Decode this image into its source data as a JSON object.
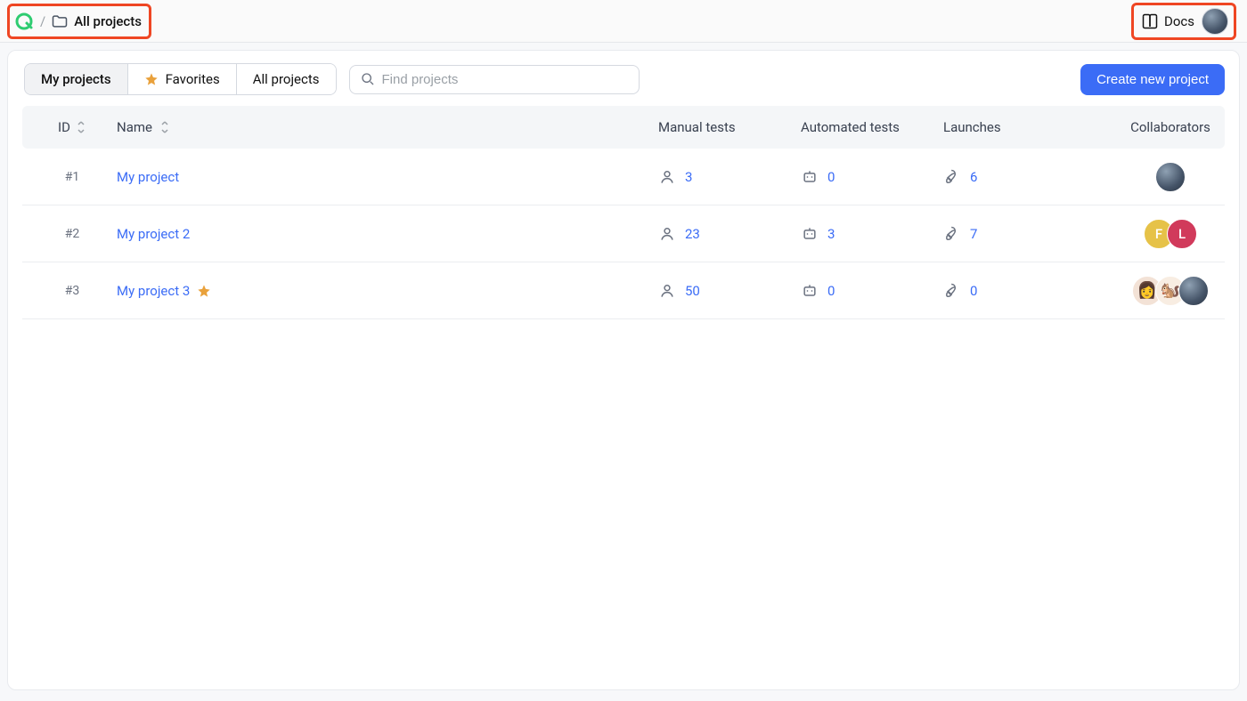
{
  "header": {
    "breadcrumb_label": "All projects",
    "docs_label": "Docs"
  },
  "toolbar": {
    "tabs": [
      {
        "label": "My projects"
      },
      {
        "label": "Favorites"
      },
      {
        "label": "All projects"
      }
    ],
    "search_placeholder": "Find projects",
    "create_label": "Create new project"
  },
  "table": {
    "columns": {
      "id": "ID",
      "name": "Name",
      "manual": "Manual tests",
      "automated": "Automated tests",
      "launches": "Launches",
      "collaborators": "Collaborators"
    },
    "rows": [
      {
        "id": "#1",
        "name": "My project",
        "favorite": false,
        "manual": "3",
        "automated": "0",
        "launches": "6",
        "collaborators": [
          {
            "type": "gray"
          }
        ]
      },
      {
        "id": "#2",
        "name": "My project 2",
        "favorite": false,
        "manual": "23",
        "automated": "3",
        "launches": "7",
        "collaborators": [
          {
            "type": "ylw",
            "initial": "F"
          },
          {
            "type": "red",
            "initial": "L"
          }
        ]
      },
      {
        "id": "#3",
        "name": "My project 3",
        "favorite": true,
        "manual": "50",
        "automated": "0",
        "launches": "0",
        "collaborators": [
          {
            "type": "emo",
            "initial": "👩"
          },
          {
            "type": "emo2",
            "initial": "🐿️"
          },
          {
            "type": "gray"
          }
        ]
      }
    ]
  }
}
